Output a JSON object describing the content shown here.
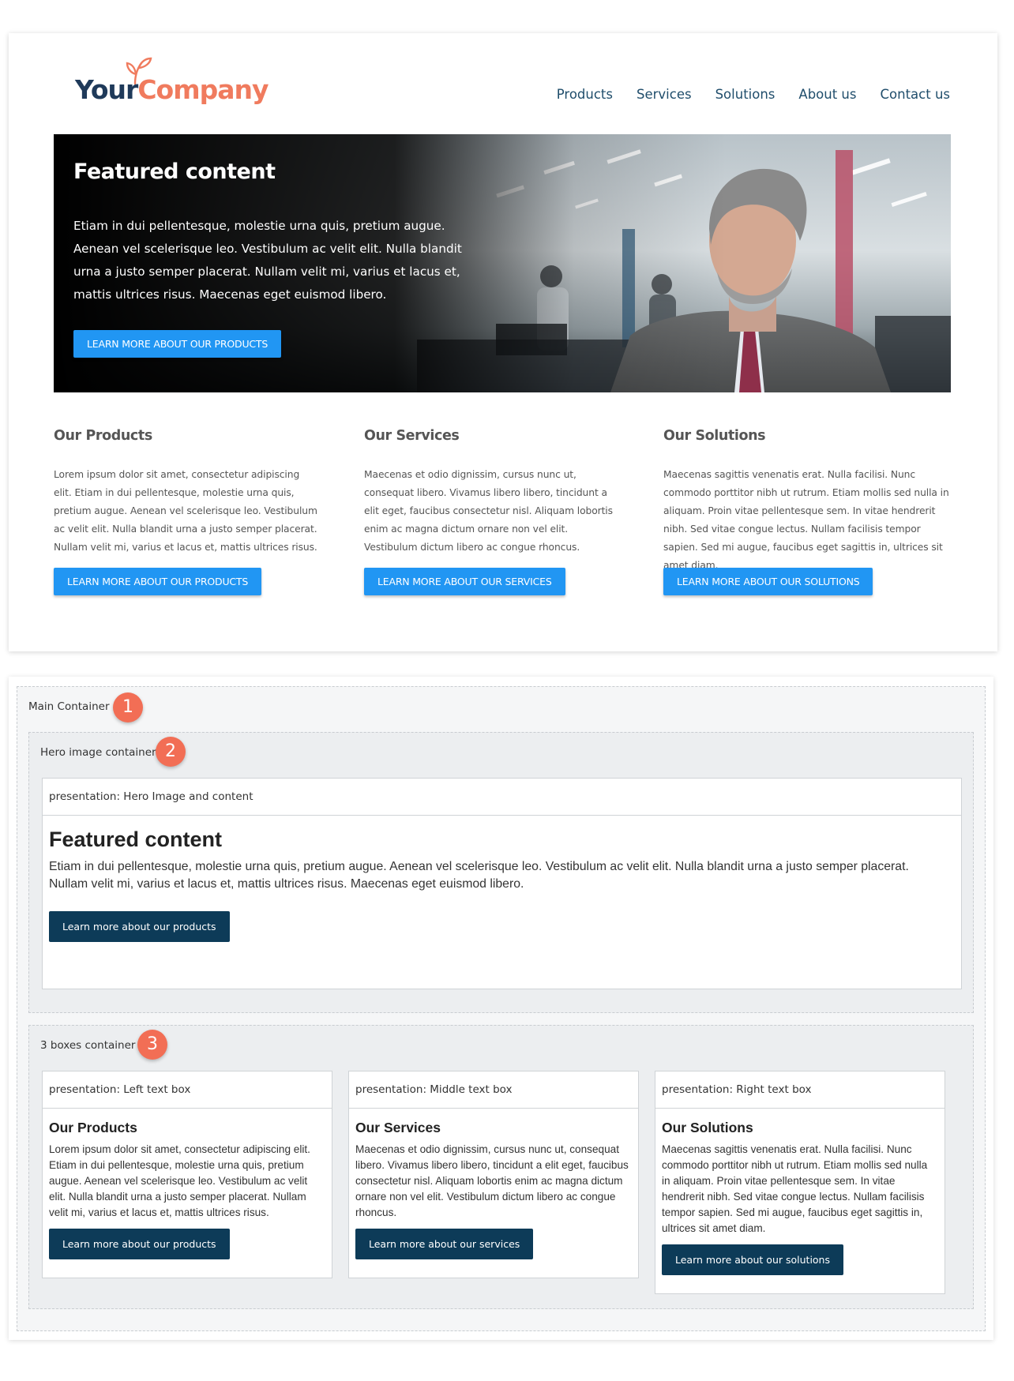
{
  "website": {
    "logo": {
      "part1": "Your",
      "part2": "Company"
    },
    "nav": [
      "Products",
      "Services",
      "Solutions",
      "About us",
      "Contact us"
    ],
    "hero": {
      "title": "Featured content",
      "text": "Etiam in dui pellentesque, molestie urna quis, pretium augue. Aenean vel scelerisque leo. Vestibulum ac velit elit. Nulla blandit urna a justo semper placerat. Nullam velit mi, varius et lacus et, mattis ultrices risus. Maecenas eget euismod libero.",
      "button": "LEARN MORE ABOUT OUR PRODUCTS"
    },
    "columns": [
      {
        "title": "Our Products",
        "text": "Lorem ipsum dolor sit amet, consectetur adipiscing elit. Etiam in dui pellentesque, molestie urna quis, pretium augue. Aenean vel scelerisque leo. Vestibulum ac velit elit. Nulla blandit urna a justo semper placerat. Nullam velit mi, varius et lacus et, mattis ultrices risus.",
        "button": "LEARN MORE ABOUT OUR PRODUCTS"
      },
      {
        "title": "Our Services",
        "text": "Maecenas et odio dignissim, cursus nunc ut, consequat libero. Vivamus libero libero, tincidunt a elit eget, faucibus consectetur nisl. Aliquam lobortis enim ac magna dictum ornare non vel elit. Vestibulum dictum libero ac congue rhoncus.",
        "button": "LEARN MORE ABOUT OUR SERVICES"
      },
      {
        "title": "Our Solutions",
        "text": "Maecenas sagittis venenatis erat. Nulla facilisi. Nunc commodo porttitor nibh ut rutrum. Etiam mollis sed nulla in aliquam. Proin vitae pellentesque sem. In vitae hendrerit nibh. Sed vitae congue lectus. Nullam facilisis tempor sapien. Sed mi augue, faucibus eget sagittis in, ultrices sit amet diam.",
        "button": "LEARN MORE ABOUT OUR SOLUTIONS"
      }
    ]
  },
  "wireframe": {
    "main_label": "Main Container",
    "main_badge": "1",
    "hero_container_label": "Hero image container",
    "hero_badge": "2",
    "hero_presentation": {
      "header": "presentation: Hero Image and content",
      "title": "Featured content",
      "text": "Etiam in dui pellentesque, molestie urna quis, pretium augue. Aenean vel scelerisque leo. Vestibulum ac velit elit. Nulla blandit urna a justo semper placerat. Nullam velit mi, varius et lacus et, mattis ultrices risus. Maecenas eget euismod libero.",
      "button": "Learn more about our products"
    },
    "boxes_container_label": "3 boxes container",
    "boxes_badge": "3",
    "boxes": [
      {
        "header": "presentation: Left text box",
        "title": "Our Products",
        "text": "Lorem ipsum dolor sit amet, consectetur adipiscing elit. Etiam in dui pellentesque, molestie urna quis, pretium augue. Aenean vel scelerisque leo. Vestibulum ac velit elit. Nulla blandit urna a justo semper placerat. Nullam velit mi, varius et lacus et, mattis ultrices risus.",
        "button": "Learn more about our products"
      },
      {
        "header": "presentation: Middle text box",
        "title": "Our Services",
        "text": "Maecenas et odio dignissim, cursus nunc ut, consequat libero. Vivamus libero libero, tincidunt a elit eget, faucibus consectetur nisl. Aliquam lobortis enim ac magna dictum ornare non vel elit. Vestibulum dictum libero ac congue rhoncus.",
        "button": "Learn more about our services"
      },
      {
        "header": "presentation: Right text box",
        "title": "Our Solutions",
        "text": "Maecenas sagittis venenatis erat. Nulla facilisi. Nunc commodo porttitor nibh ut rutrum. Etiam mollis sed nulla in aliquam. Proin vitae pellentesque sem. In vitae hendrerit nibh. Sed vitae congue lectus. Nullam facilisis tempor sapien. Sed mi augue, faucibus eget sagittis in, ultrices sit amet diam.",
        "button": "Learn more about our solutions"
      }
    ]
  },
  "colors": {
    "primary_blue": "#2196f3",
    "dark_navy": "#0d3b58",
    "logo_navy": "#1f3a5a",
    "logo_coral": "#f07b5e",
    "badge": "#f26e55",
    "nav_text": "#1f4d6b"
  },
  "icons": [
    "sprout-icon"
  ]
}
